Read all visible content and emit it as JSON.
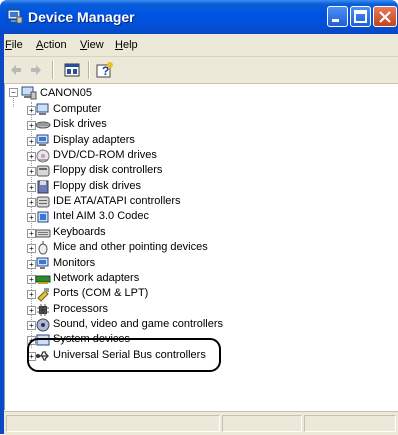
{
  "window": {
    "title": "Device Manager"
  },
  "menu": [
    {
      "label": "File",
      "access": "F",
      "rest": "ile"
    },
    {
      "label": "Action",
      "access": "A",
      "rest": "ction"
    },
    {
      "label": "View",
      "access": "V",
      "rest": "iew"
    },
    {
      "label": "Help",
      "access": "H",
      "rest": "elp"
    }
  ],
  "toolbar": [
    "back-icon",
    "forward-icon",
    "properties-icon",
    "help-icon"
  ],
  "tree": {
    "root": "CANON05",
    "items": [
      "Computer",
      "Disk drives",
      "Display adapters",
      "DVD/CD-ROM drives",
      "Floppy disk controllers",
      "Floppy disk drives",
      "IDE ATA/ATAPI controllers",
      "Intel AIM 3.0 Codec",
      "Keyboards",
      "Mice and other pointing devices",
      "Monitors",
      "Network adapters",
      "Ports (COM & LPT)",
      "Processors",
      "Sound, video and game controllers",
      "System devices",
      "Universal Serial Bus controllers"
    ],
    "highlighted": "Universal Serial Bus controllers"
  }
}
